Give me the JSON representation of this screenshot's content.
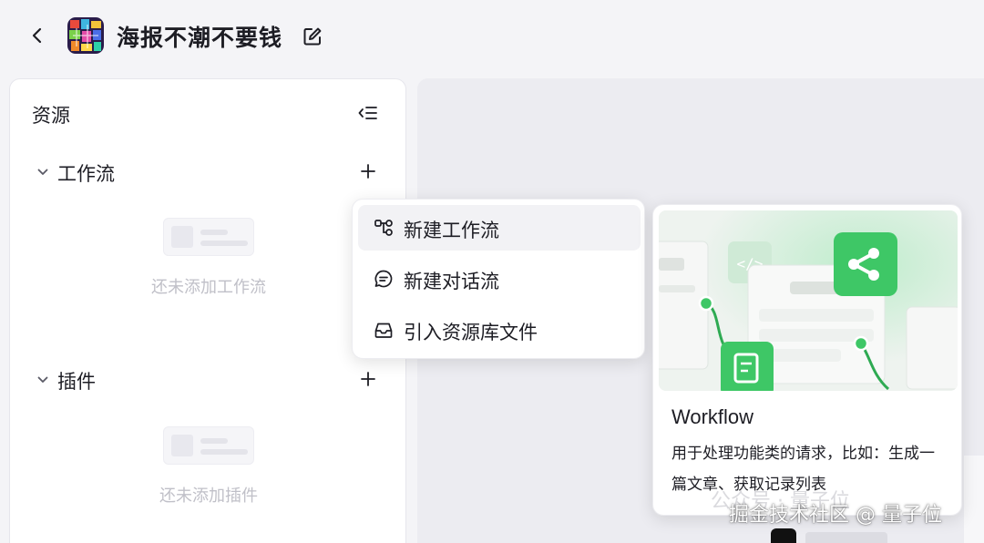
{
  "header": {
    "app_name": "海报不潮不要钱",
    "avatar_icon": "app-avatar-image",
    "back_icon": "chevron-left-icon",
    "edit_icon": "edit-icon"
  },
  "resources": {
    "title": "资源",
    "collapse_icon": "collapse-list-icon",
    "sections": [
      {
        "label": "工作流",
        "empty_text": "还未添加工作流"
      },
      {
        "label": "插件",
        "empty_text": "还未添加插件"
      }
    ]
  },
  "menu": {
    "items": [
      {
        "label": "新建工作流",
        "icon": "workflow-icon"
      },
      {
        "label": "新建对话流",
        "icon": "chat-icon"
      },
      {
        "label": "引入资源库文件",
        "icon": "inbox-icon"
      }
    ]
  },
  "preview": {
    "title": "Workflow",
    "description": "用于处理功能类的请求，比如：生成一篇文章、获取记录列表",
    "accent_color": "#3ec766"
  },
  "watermark": {
    "text": "掘金技术社区 @ 量子位",
    "faint_text": "公众号 · 量子位"
  }
}
